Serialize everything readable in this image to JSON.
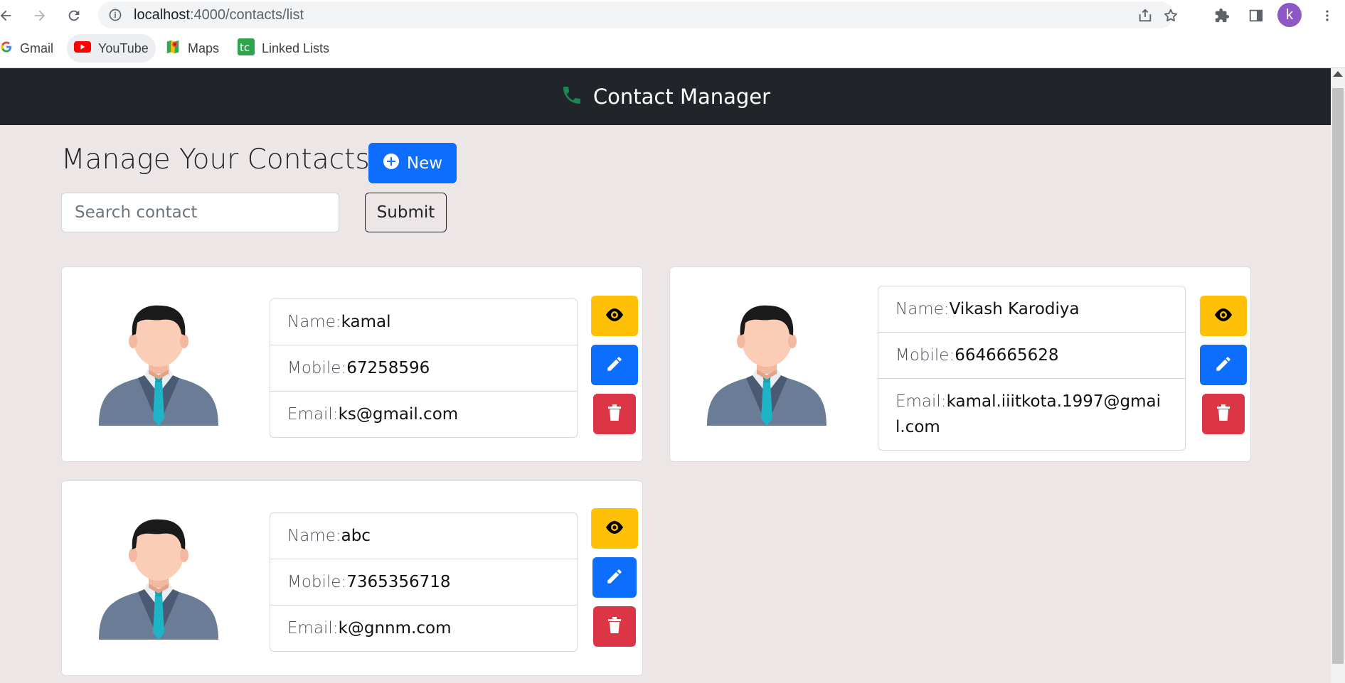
{
  "browser": {
    "url_host": "localhost",
    "url_path": ":4000/contacts/list",
    "profile_initial": "k",
    "bookmarks": [
      "Gmail",
      "YouTube",
      "Maps",
      "Linked Lists"
    ]
  },
  "app": {
    "brand": "Contact Manager",
    "page_title": "Manage Your Contacts",
    "new_label": "New",
    "search_placeholder": "Search contact",
    "submit_label": "Submit",
    "name_label": "Name:",
    "mobile_label": "Mobile:",
    "email_label": "Email:"
  },
  "contacts": [
    {
      "name": "kamal",
      "mobile": "67258596",
      "email": "ks@gmail.com"
    },
    {
      "name": "Vikash Karodiya",
      "mobile": "6646665628",
      "email": "kamal.iiitkota.1997@gmail.com"
    },
    {
      "name": "abc",
      "mobile": "7365356718",
      "email": "k@gnnm.com"
    }
  ],
  "colors": {
    "navbar": "#212529",
    "primary": "#0d6efd",
    "warning": "#ffc107",
    "danger": "#dc3545",
    "page_bg": "#ece6e6"
  }
}
